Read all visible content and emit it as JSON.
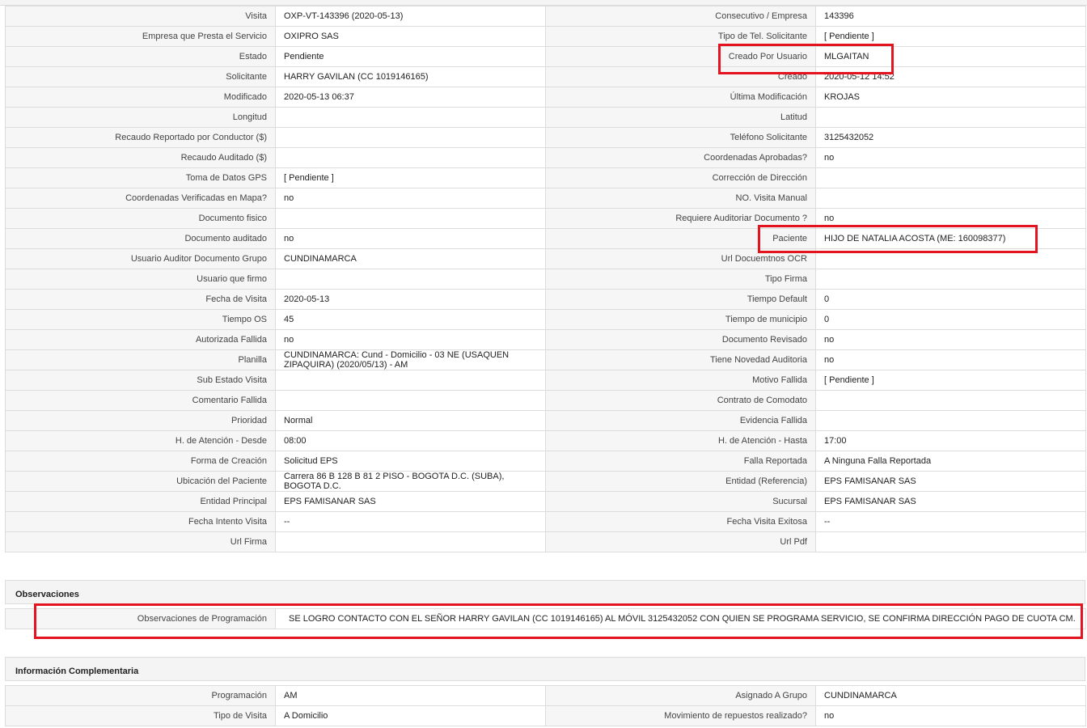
{
  "main": {
    "rows": [
      [
        {
          "l": "Visita",
          "v": "OXP-VT-143396 (2020-05-13)"
        },
        {
          "l": "Consecutivo / Empresa",
          "v": "143396"
        }
      ],
      [
        {
          "l": "Empresa que Presta el Servicio",
          "v": "OXIPRO SAS"
        },
        {
          "l": "Tipo de Tel. Solicitante",
          "v": "[ Pendiente ]"
        }
      ],
      [
        {
          "l": "Estado",
          "v": "Pendiente"
        },
        {
          "l": "Creado Por Usuario",
          "v": "MLGAITAN"
        }
      ],
      [
        {
          "l": "Solicitante",
          "v": "HARRY GAVILAN (CC 1019146165)"
        },
        {
          "l": "Creado",
          "v": "2020-05-12 14:52"
        }
      ],
      [
        {
          "l": "Modificado",
          "v": "2020-05-13 06:37"
        },
        {
          "l": "Última Modificación",
          "v": " KROJAS"
        }
      ],
      [
        {
          "l": "Longitud",
          "v": ""
        },
        {
          "l": "Latitud",
          "v": ""
        }
      ],
      [
        {
          "l": "Recaudo Reportado por Conductor ($)",
          "v": ""
        },
        {
          "l": "Teléfono Solicitante",
          "v": "3125432052"
        }
      ],
      [
        {
          "l": "Recaudo Auditado ($)",
          "v": ""
        },
        {
          "l": "Coordenadas Aprobadas?",
          "v": " no"
        }
      ],
      [
        {
          "l": "Toma de Datos GPS",
          "v": "[ Pendiente ]"
        },
        {
          "l": "Corrección de Dirección",
          "v": ""
        }
      ],
      [
        {
          "l": "Coordenadas Verificadas en Mapa?",
          "v": " no"
        },
        {
          "l": "NO. Visita Manual",
          "v": ""
        }
      ],
      [
        {
          "l": "Documento fisico",
          "v": ""
        },
        {
          "l": "Requiere Auditoriar Documento ?",
          "v": " no"
        }
      ],
      [
        {
          "l": "Documento auditado",
          "v": " no"
        },
        {
          "l": "Paciente",
          "v": "HIJO DE NATALIA ACOSTA (ME: 160098377)"
        }
      ],
      [
        {
          "l": "Usuario Auditor Documento Grupo",
          "v": "CUNDINAMARCA"
        },
        {
          "l": "Url Docuemtnos OCR",
          "v": ""
        }
      ],
      [
        {
          "l": "Usuario que firmo",
          "v": ""
        },
        {
          "l": "Tipo Firma",
          "v": ""
        }
      ],
      [
        {
          "l": "Fecha de Visita",
          "v": " 2020-05-13"
        },
        {
          "l": "Tiempo Default",
          "v": "0"
        }
      ],
      [
        {
          "l": "Tiempo OS",
          "v": "45"
        },
        {
          "l": "Tiempo de municipio",
          "v": "0"
        }
      ],
      [
        {
          "l": "Autorizada Fallida",
          "v": " no"
        },
        {
          "l": "Documento Revisado",
          "v": " no"
        }
      ],
      [
        {
          "l": "Planilla",
          "v": "CUNDINAMARCA: Cund - Domicilio - 03 NE (USAQUEN ZIPAQUIRA) (2020/05/13) - AM"
        },
        {
          "l": "Tiene Novedad Auditoria",
          "v": " no"
        }
      ],
      [
        {
          "l": "Sub Estado Visita",
          "v": ""
        },
        {
          "l": "Motivo Fallida",
          "v": "[ Pendiente ]"
        }
      ],
      [
        {
          "l": "Comentario Fallida",
          "v": ""
        },
        {
          "l": "Contrato de Comodato",
          "v": ""
        }
      ],
      [
        {
          "l": "Prioridad",
          "v": "Normal"
        },
        {
          "l": "Evidencia Fallida",
          "v": ""
        }
      ],
      [
        {
          "l": "H. de Atención - Desde",
          "v": "08:00"
        },
        {
          "l": "H. de Atención - Hasta",
          "v": "17:00"
        }
      ],
      [
        {
          "l": "Forma de Creación",
          "v": "Solicitud EPS"
        },
        {
          "l": "Falla Reportada",
          "v": "A Ninguna Falla Reportada"
        }
      ],
      [
        {
          "l": "Ubicación del Paciente",
          "v": "Carrera 86 B 128 B 81 2 PISO - BOGOTA D.C. (SUBA), BOGOTA D.C."
        },
        {
          "l": "Entidad (Referencia)",
          "v": "EPS FAMISANAR SAS"
        }
      ],
      [
        {
          "l": "Entidad Principal",
          "v": "EPS FAMISANAR SAS"
        },
        {
          "l": "Sucursal",
          "v": "EPS FAMISANAR SAS"
        }
      ],
      [
        {
          "l": "Fecha Intento Visita",
          "v": " --"
        },
        {
          "l": "Fecha Visita Exitosa",
          "v": " --"
        }
      ],
      [
        {
          "l": "Url Firma",
          "v": ""
        },
        {
          "l": "Url Pdf",
          "v": ""
        }
      ]
    ]
  },
  "observaciones": {
    "title": "Observaciones",
    "label": "Observaciones de Programación",
    "value": "SE LOGRO CONTACTO CON EL SEÑOR HARRY GAVILAN (CC 1019146165) AL MÓVIL 3125432052 CON QUIEN SE PROGRAMA SERVICIO, SE CONFIRMA DIRECCIÓN PAGO DE CUOTA CM."
  },
  "complementaria": {
    "title": "Información Complementaria",
    "rows": [
      [
        {
          "l": "Programación",
          "v": "AM"
        },
        {
          "l": "Asignado A Grupo",
          "v": "CUNDINAMARCA"
        }
      ],
      [
        {
          "l": "Tipo de Visita",
          "v": "A Domicilio"
        },
        {
          "l": "Movimiento de repuestos realizado?",
          "v": " no"
        }
      ]
    ]
  },
  "colors": {
    "highlight": "#e3141f",
    "label_bg": "#f6f6f6",
    "border": "#dcdcdc"
  }
}
